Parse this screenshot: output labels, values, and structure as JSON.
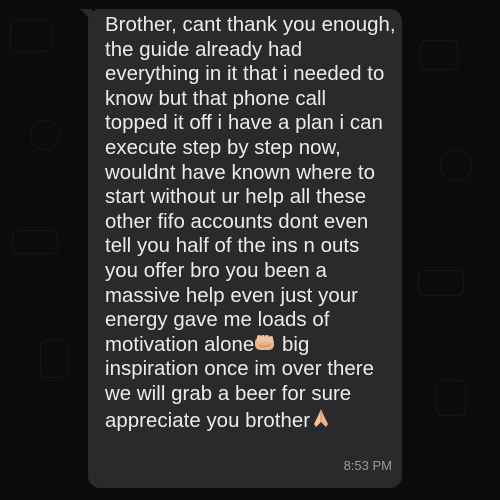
{
  "message": {
    "lines": [
      "Brother, cant thank you enough,",
      "the guide already had",
      "everything in it that i needed to",
      "know but that phone call",
      "topped it off i have a plan i can",
      "execute step by step now,",
      "wouldnt have known where to",
      "start without ur help all these",
      "other fifo accounts dont even",
      "tell you half of the ins n outs",
      "you offer bro you been a",
      "massive help even just your",
      "energy gave me loads of",
      "motivation alone",
      "inspiration once im over there",
      "we will grab a beer for sure",
      "appreciate you brother"
    ],
    "line14_after_emoji": " big",
    "emoji_fist": "fist-bump-emoji",
    "emoji_pray": "praying-hands-emoji",
    "time": "8:53 PM"
  },
  "colors": {
    "background": "#0b0b0b",
    "bubble": "#2a2a2c",
    "text": "#ececec",
    "time": "#9a9a9a"
  }
}
